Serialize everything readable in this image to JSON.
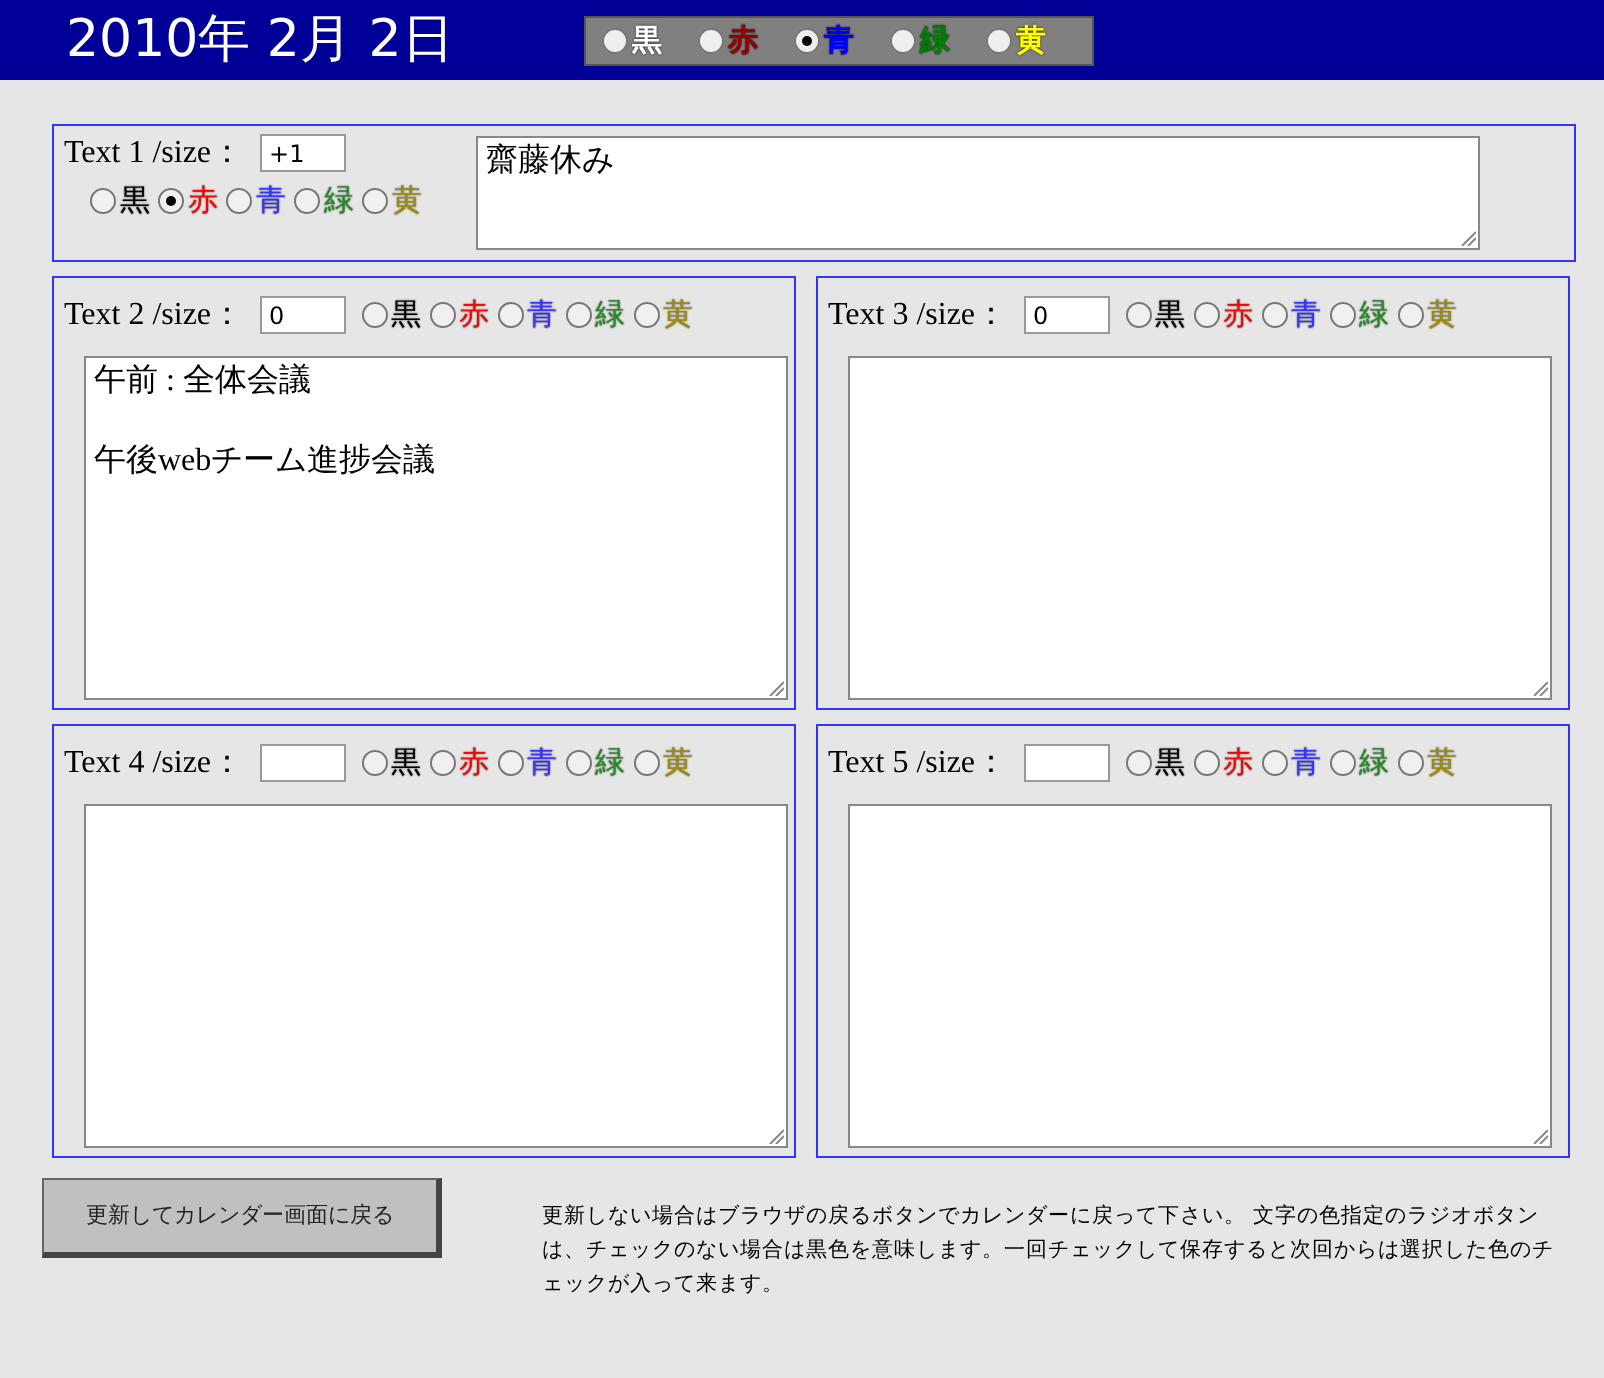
{
  "header": {
    "date": "2010年 2月 2日",
    "colors": [
      {
        "label": "黒",
        "color": "#ffffff",
        "selected": false
      },
      {
        "label": "赤",
        "color": "#990000",
        "selected": false
      },
      {
        "label": "青",
        "color": "#0000ff",
        "selected": true
      },
      {
        "label": "緑",
        "color": "#008000",
        "selected": false
      },
      {
        "label": "黄",
        "color": "#ffff00",
        "selected": false
      }
    ]
  },
  "texts": [
    {
      "label": "Text 1 /size：",
      "size": "+1",
      "lines": [
        "齋藤休み"
      ],
      "colors": [
        {
          "label": "黒",
          "color": "#000000",
          "selected": false
        },
        {
          "label": "赤",
          "color": "#ff0000",
          "selected": true
        },
        {
          "label": "青",
          "color": "#3333ff",
          "selected": false
        },
        {
          "label": "緑",
          "color": "#228b22",
          "selected": false
        },
        {
          "label": "黄",
          "color": "#a08c00",
          "selected": false
        }
      ]
    },
    {
      "label": "Text 2 /size：",
      "size": "0",
      "lines": [
        "午前 : 全体会議",
        "午後webチーム進捗会議"
      ],
      "colors": [
        {
          "label": "黒",
          "color": "#000000",
          "selected": false
        },
        {
          "label": "赤",
          "color": "#ff0000",
          "selected": false
        },
        {
          "label": "青",
          "color": "#3333ff",
          "selected": false
        },
        {
          "label": "緑",
          "color": "#228b22",
          "selected": false
        },
        {
          "label": "黄",
          "color": "#a08c00",
          "selected": false
        }
      ]
    },
    {
      "label": "Text 3 /size：",
      "size": "0",
      "colors": [
        {
          "label": "黒",
          "color": "#000000",
          "selected": false
        },
        {
          "label": "赤",
          "color": "#ff0000",
          "selected": false
        },
        {
          "label": "青",
          "color": "#3333ff",
          "selected": false
        },
        {
          "label": "緑",
          "color": "#228b22",
          "selected": false
        },
        {
          "label": "黄",
          "color": "#a08c00",
          "selected": false
        }
      ]
    },
    {
      "label": "Text 4 /size：",
      "colors": [
        {
          "label": "黒",
          "color": "#000000",
          "selected": false
        },
        {
          "label": "赤",
          "color": "#ff0000",
          "selected": false
        },
        {
          "label": "青",
          "color": "#3333ff",
          "selected": false
        },
        {
          "label": "緑",
          "color": "#228b22",
          "selected": false
        },
        {
          "label": "黄",
          "color": "#a08c00",
          "selected": false
        }
      ]
    },
    {
      "label": "Text 5 /size：",
      "colors": [
        {
          "label": "黒",
          "color": "#000000",
          "selected": false
        },
        {
          "label": "赤",
          "color": "#ff0000",
          "selected": false
        },
        {
          "label": "青",
          "color": "#3333ff",
          "selected": false
        },
        {
          "label": "緑",
          "color": "#228b22",
          "selected": false
        },
        {
          "label": "黄",
          "color": "#a08c00",
          "selected": false
        }
      ]
    }
  ],
  "button": "更新してカレンダー画面に戻る",
  "note": "更新しない場合はブラウザの戻るボタンでカレンダーに戻って下さい。 文字の色指定のラジオボタンは、チェックのない場合は黒色を意味します。一回チェックして保存すると次回からは選択した色のチェックが入って来ます。"
}
